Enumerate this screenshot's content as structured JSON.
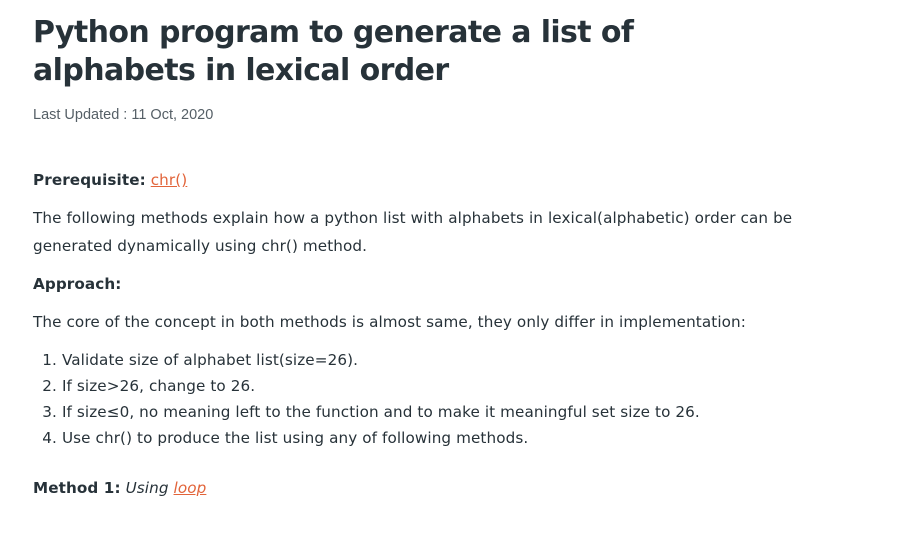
{
  "article": {
    "title": "Python program to generate a list of alphabets in lexical order",
    "last_updated": "Last Updated : 11 Oct, 2020",
    "prerequisite_label": "Prerequisite:",
    "prerequisite_link": "chr()",
    "intro": "The following methods explain how a python list with alphabets in lexical(alphabetic) order can be generated dynamically using chr() method.",
    "approach_heading": "Approach:",
    "approach_text": "The core of the concept in both methods is almost same, they only differ in implementation:",
    "steps": [
      {
        "num": "1.",
        "text": "Validate size of alphabet list(size=26)."
      },
      {
        "num": "2.",
        "text": "If size>26, change to 26."
      },
      {
        "num": "3.",
        "text": "If size≤0, no meaning left to the function and to make it meaningful set size to 26."
      },
      {
        "num": "4.",
        "text": "Use chr() to produce the list using any of following methods."
      }
    ],
    "method1_label": "Method 1:",
    "method1_using": "Using",
    "method1_link": "loop"
  },
  "colors": {
    "text": "#273239",
    "muted": "#555f66",
    "link": "#e2643a",
    "background": "#ffffff"
  }
}
